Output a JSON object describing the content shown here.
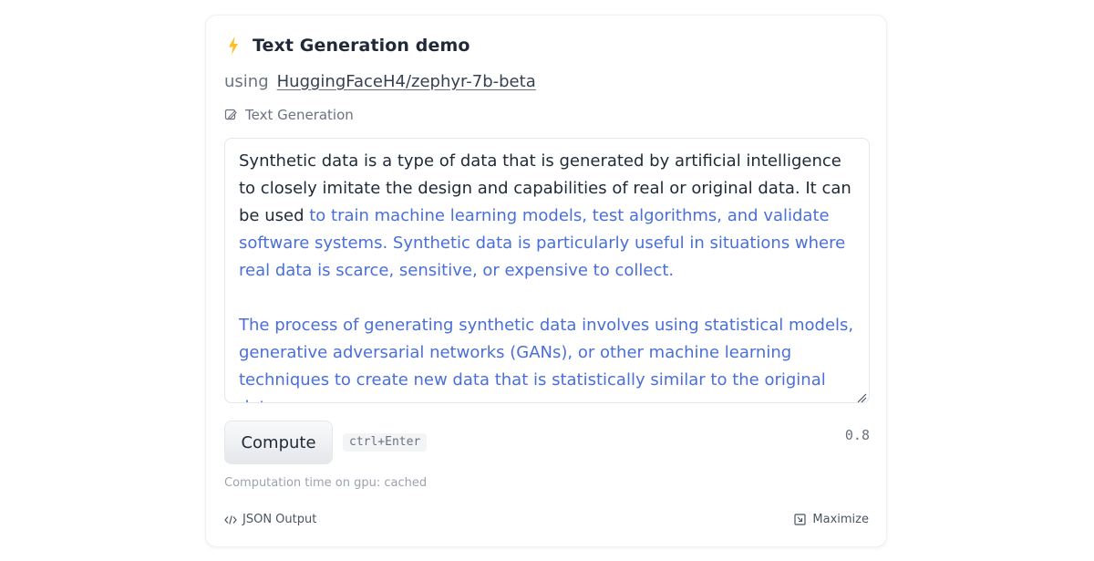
{
  "widget": {
    "title": "Text Generation demo",
    "using_label": "using",
    "model_name": "HuggingFaceH4/zephyr-7b-beta",
    "task_label": "Text Generation",
    "icons": {
      "title": "lightning-bolt-icon",
      "task": "pencil-tag-icon",
      "json": "code-brackets-icon",
      "maximize": "maximize-icon"
    },
    "colors": {
      "prompt_text": "#1f2937",
      "generated_text": "#4a6fd6",
      "bolt": "#fbbf24"
    }
  },
  "textarea": {
    "prompt": "Synthetic data is a type of data that is generated by artificial intelligence to closely imitate the design and capabilities of real or original data. It can be used",
    "generated_part1": " to train machine learning models, test algorithms, and validate software systems. Synthetic data is particularly useful in situations where real data is scarce, sensitive, or expensive to collect.",
    "generated_part2": "The process of generating synthetic data involves using statistical models, generative adversarial networks (GANs), or other machine learning techniques to create new data that is statistically similar to the original data."
  },
  "actions": {
    "compute_label": "Compute",
    "shortcut": "ctrl+Enter",
    "score": "0.8"
  },
  "status": {
    "computation_time": "Computation time on gpu: cached"
  },
  "footer": {
    "json_output_label": "JSON Output",
    "maximize_label": "Maximize"
  }
}
